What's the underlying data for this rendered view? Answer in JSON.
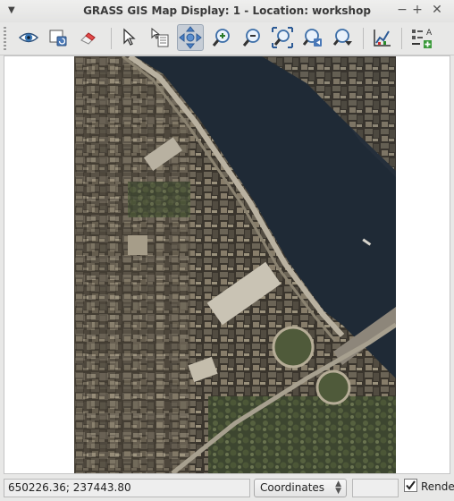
{
  "window": {
    "title": "GRASS GIS Map Display: 1  - Location: workshop"
  },
  "toolbar": {
    "tools": [
      "display-map-icon",
      "render-map-icon",
      "erase-icon",
      "pointer-icon",
      "query-icon",
      "pan-icon",
      "zoom-in-icon",
      "zoom-out-icon",
      "zoom-extent-icon",
      "zoom-back-icon",
      "zoom-options-icon",
      "analyze-icon",
      "decorations-icon"
    ],
    "active_tool": "pan-icon"
  },
  "statusbar": {
    "coordinates": "650226.36; 237443.80",
    "mode": "Coordinates",
    "render_label": "Render",
    "render_checked": true
  },
  "colors": {
    "water": "#1f2a36",
    "active_tool": "#c6cdd6"
  }
}
